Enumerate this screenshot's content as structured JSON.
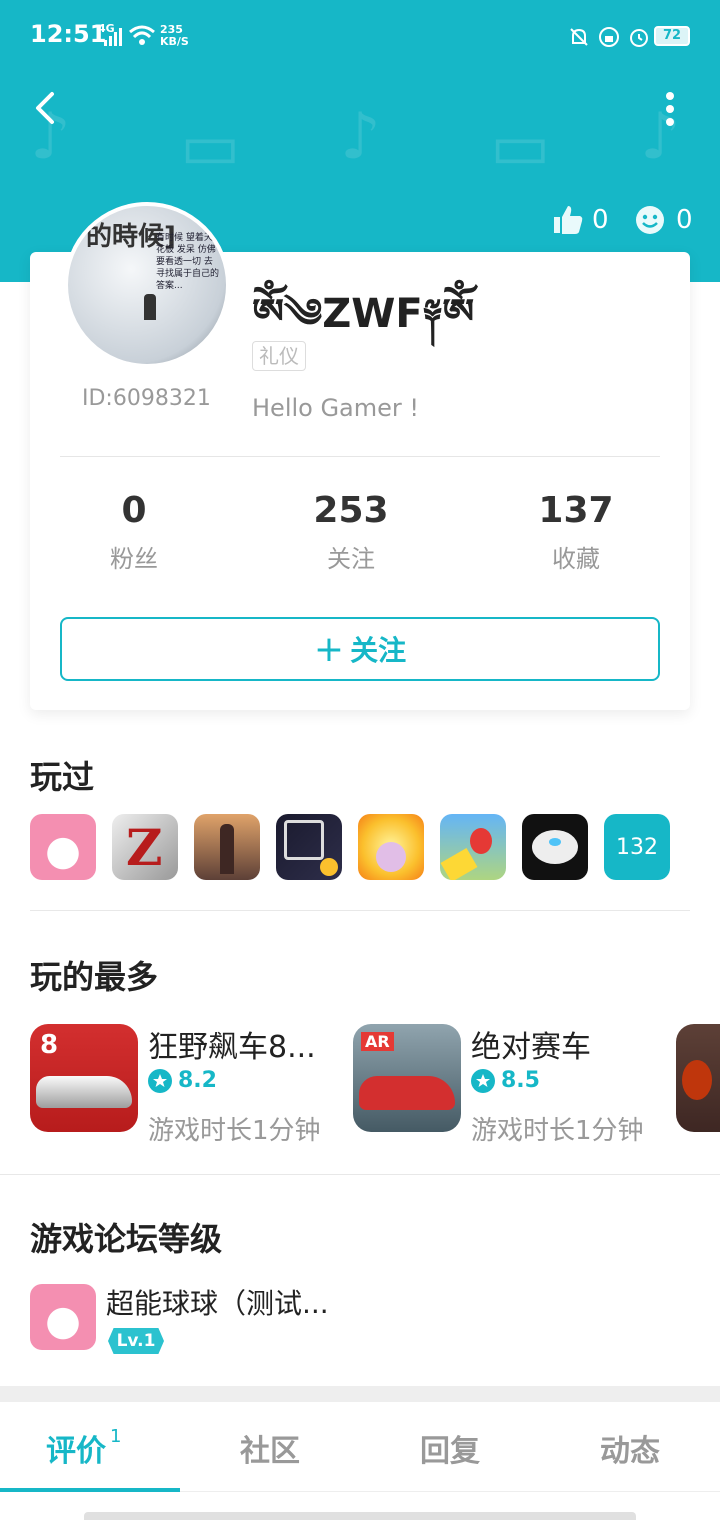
{
  "status_bar": {
    "time": "12:51",
    "network": "4G",
    "speed_value": "235",
    "speed_unit": "KB/S",
    "battery": "72"
  },
  "profile": {
    "username": "ༀ༄ZWF༈ༀ",
    "tag": "礼仪",
    "id_text": "ID:6098321",
    "bio": "Hello Gamer !",
    "avatar_text_main": "的時候]",
    "avatar_text_small": "有时候 望着天花板 发呆 仿佛要看透一切 去寻找属于自己的 答案..."
  },
  "reactions": {
    "likes": "0",
    "smiles": "0"
  },
  "stats": [
    {
      "value": "0",
      "label": "粉丝"
    },
    {
      "value": "253",
      "label": "关注"
    },
    {
      "value": "137",
      "label": "收藏"
    }
  ],
  "follow_button": {
    "plus": "+",
    "label": "关注"
  },
  "played": {
    "title": "玩过",
    "more_count": "132"
  },
  "most_played": {
    "title": "玩的最多",
    "items": [
      {
        "name": "狂野飙车8...",
        "rating": "8.2",
        "time": "游戏时长1分钟"
      },
      {
        "name": "绝对赛车",
        "rating": "8.5",
        "time": "游戏时长1分钟"
      }
    ]
  },
  "forum": {
    "title": "游戏论坛等级",
    "game_name": "超能球球（测试...",
    "level": "Lv.1"
  },
  "tabs": [
    {
      "label": "评价",
      "count": "1"
    },
    {
      "label": "社区"
    },
    {
      "label": "回复"
    },
    {
      "label": "动态"
    }
  ],
  "colors": {
    "accent": "#16b7c7"
  }
}
